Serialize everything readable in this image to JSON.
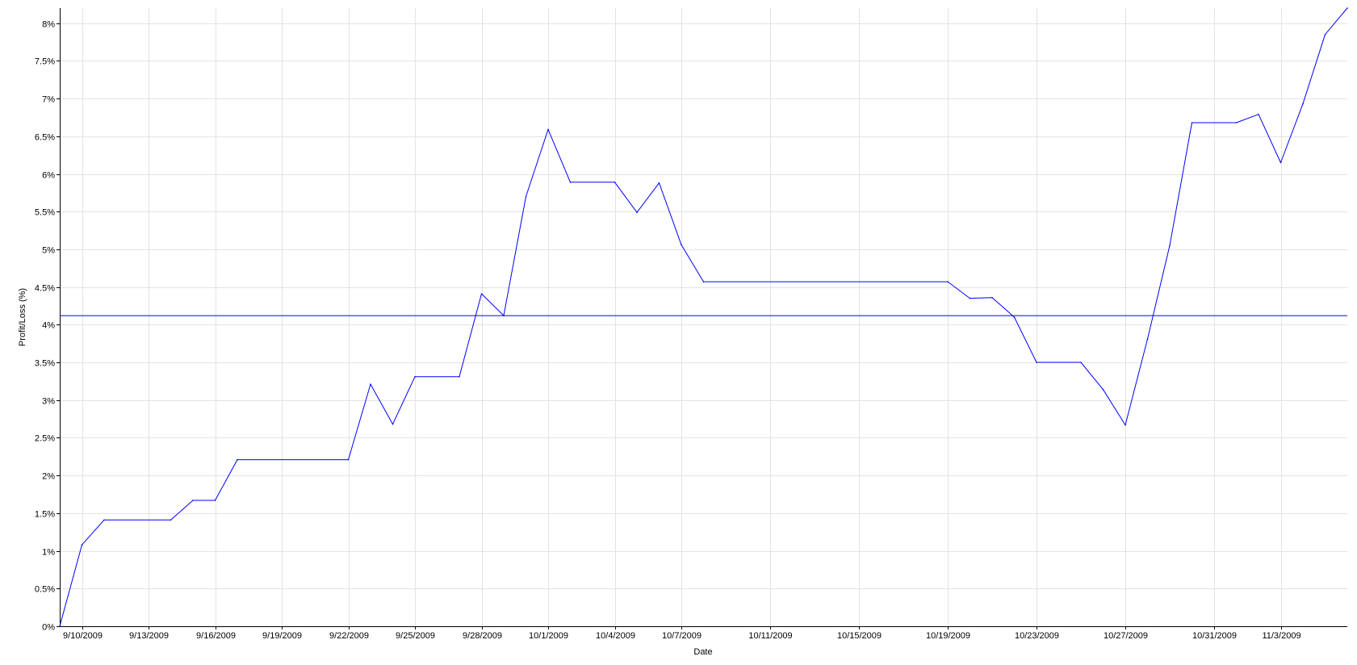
{
  "chart_data": {
    "type": "line",
    "title": "",
    "xlabel": "Date",
    "ylabel": "Profit/Loss (%)",
    "ylim": [
      0,
      8.2
    ],
    "y_ticks": [
      {
        "value": 0,
        "label": "0%"
      },
      {
        "value": 0.5,
        "label": "0.5%"
      },
      {
        "value": 1,
        "label": "1%"
      },
      {
        "value": 1.5,
        "label": "1.5%"
      },
      {
        "value": 2,
        "label": "2%"
      },
      {
        "value": 2.5,
        "label": "2.5%"
      },
      {
        "value": 3,
        "label": "3%"
      },
      {
        "value": 3.5,
        "label": "3.5%"
      },
      {
        "value": 4,
        "label": "4%"
      },
      {
        "value": 4.5,
        "label": "4.5%"
      },
      {
        "value": 5,
        "label": "5%"
      },
      {
        "value": 5.5,
        "label": "5.5%"
      },
      {
        "value": 6,
        "label": "6%"
      },
      {
        "value": 6.5,
        "label": "6.5%"
      },
      {
        "value": 7,
        "label": "7%"
      },
      {
        "value": 7.5,
        "label": "7.5%"
      },
      {
        "value": 8,
        "label": "8%"
      }
    ],
    "x_range": [
      "2009-09-09",
      "2009-11-06"
    ],
    "x_ticks": [
      {
        "date": "2009-09-10",
        "label": "9/10/2009"
      },
      {
        "date": "2009-09-13",
        "label": "9/13/2009"
      },
      {
        "date": "2009-09-16",
        "label": "9/16/2009"
      },
      {
        "date": "2009-09-19",
        "label": "9/19/2009"
      },
      {
        "date": "2009-09-22",
        "label": "9/22/2009"
      },
      {
        "date": "2009-09-25",
        "label": "9/25/2009"
      },
      {
        "date": "2009-09-28",
        "label": "9/28/2009"
      },
      {
        "date": "2009-10-01",
        "label": "10/1/2009"
      },
      {
        "date": "2009-10-04",
        "label": "10/4/2009"
      },
      {
        "date": "2009-10-07",
        "label": "10/7/2009"
      },
      {
        "date": "2009-10-11",
        "label": "10/11/2009"
      },
      {
        "date": "2009-10-15",
        "label": "10/15/2009"
      },
      {
        "date": "2009-10-19",
        "label": "10/19/2009"
      },
      {
        "date": "2009-10-23",
        "label": "10/23/2009"
      },
      {
        "date": "2009-10-27",
        "label": "10/27/2009"
      },
      {
        "date": "2009-10-31",
        "label": "10/31/2009"
      },
      {
        "date": "2009-11-03",
        "label": "11/3/2009"
      }
    ],
    "grid": true,
    "series": [
      {
        "color": "#0000ff",
        "points": [
          [
            "2009-09-09",
            0.0
          ],
          [
            "2009-09-10",
            1.08
          ],
          [
            "2009-09-11",
            1.41
          ],
          [
            "2009-09-14",
            1.41
          ],
          [
            "2009-09-15",
            1.67
          ],
          [
            "2009-09-16",
            1.67
          ],
          [
            "2009-09-17",
            2.21
          ],
          [
            "2009-09-22",
            2.21
          ],
          [
            "2009-09-23",
            3.21
          ],
          [
            "2009-09-24",
            2.68
          ],
          [
            "2009-09-25",
            3.31
          ],
          [
            "2009-09-27",
            3.31
          ],
          [
            "2009-09-28",
            4.41
          ],
          [
            "2009-09-29",
            4.12
          ],
          [
            "2009-09-30",
            5.7
          ],
          [
            "2009-10-01",
            6.59
          ],
          [
            "2009-10-02",
            5.89
          ],
          [
            "2009-10-04",
            5.89
          ],
          [
            "2009-10-05",
            5.49
          ],
          [
            "2009-10-06",
            5.88
          ],
          [
            "2009-10-07",
            5.06
          ],
          [
            "2009-10-08",
            4.57
          ],
          [
            "2009-10-19",
            4.57
          ],
          [
            "2009-10-20",
            4.35
          ],
          [
            "2009-10-21",
            4.36
          ],
          [
            "2009-10-22",
            4.1
          ],
          [
            "2009-10-23",
            3.5
          ],
          [
            "2009-10-25",
            3.5
          ],
          [
            "2009-10-26",
            3.14
          ],
          [
            "2009-10-27",
            2.67
          ],
          [
            "2009-10-28",
            3.81
          ],
          [
            "2009-10-29",
            5.05
          ],
          [
            "2009-10-30",
            6.68
          ],
          [
            "2009-11-01",
            6.68
          ],
          [
            "2009-11-02",
            6.79
          ],
          [
            "2009-11-03",
            6.15
          ],
          [
            "2009-11-04",
            6.93
          ],
          [
            "2009-11-05",
            7.85
          ],
          [
            "2009-11-06",
            8.2
          ]
        ]
      }
    ],
    "reference_line": {
      "value": 4.12,
      "color": "#0000ff"
    }
  }
}
